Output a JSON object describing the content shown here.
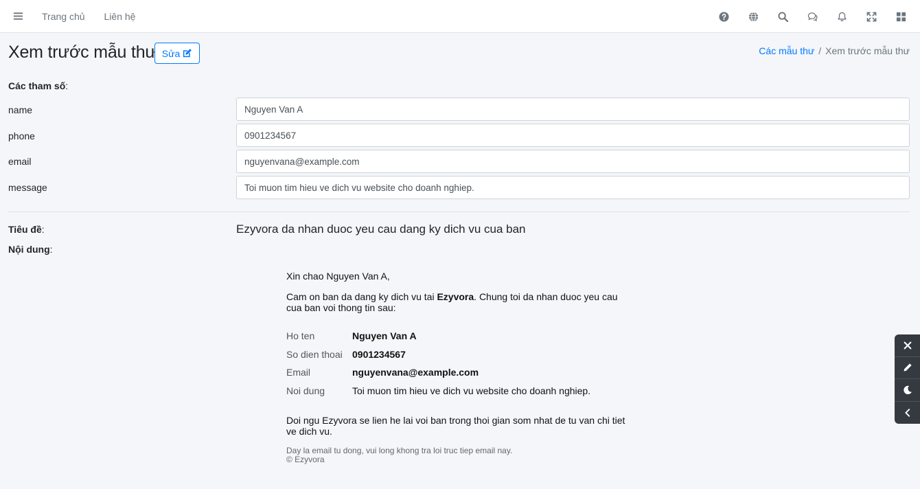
{
  "nav": {
    "links": [
      "Trang chủ",
      "Liên hệ"
    ]
  },
  "header": {
    "title": "Xem trước mẫu thư",
    "edit_label": "Sửa"
  },
  "breadcrumb": {
    "link": "Các mẫu thư",
    "separator": "/",
    "active": "Xem trước mẫu thư"
  },
  "params": {
    "heading": "Các tham số",
    "fields": [
      {
        "label": "name",
        "value": "Nguyen Van A"
      },
      {
        "label": "phone",
        "value": "0901234567"
      },
      {
        "label": "email",
        "value": "nguyenvana@example.com"
      },
      {
        "label": "message",
        "value": "Toi muon tim hieu ve dich vu website cho doanh nghiep."
      }
    ]
  },
  "subject": {
    "label": "Tiêu đề",
    "value": "Ezyvora da nhan duoc yeu cau dang ky dich vu cua ban"
  },
  "content": {
    "label": "Nội dung"
  },
  "email": {
    "greeting": "Xin chao Nguyen Van A,",
    "thanks_pre": "Cam on ban da dang ky dich vu tai ",
    "brand": "Ezyvora",
    "thanks_post": ". Chung toi da nhan duoc yeu cau cua ban voi thong tin sau:",
    "rows": [
      {
        "key": "Ho ten",
        "value": "Nguyen Van A"
      },
      {
        "key": "So dien thoai",
        "value": "0901234567"
      },
      {
        "key": "Email",
        "value": "nguyenvana@example.com"
      },
      {
        "key": "Noi dung",
        "value": "Toi muon tim hieu ve dich vu website cho doanh nghiep."
      }
    ],
    "closing": "Doi ngu Ezyvora se lien he lai voi ban trong thoi gian som nhat de tu van chi tiet ve dich vu.",
    "footer_line1": "Day la email tu dong, vui long khong tra loi truc tiep email nay.",
    "footer_line2": "© Ezyvora"
  },
  "icons": {
    "nav_right": [
      "question-circle-icon",
      "globe-icon",
      "search-icon",
      "comments-icon",
      "bell-icon",
      "expand-icon",
      "grid-icon"
    ],
    "float": [
      "close-icon",
      "pencil-icon",
      "moon-icon",
      "chevron-left-icon"
    ]
  },
  "colors": {
    "accent": "#007bff",
    "background": "#f4f6f9",
    "panel_dark": "#343a40"
  }
}
